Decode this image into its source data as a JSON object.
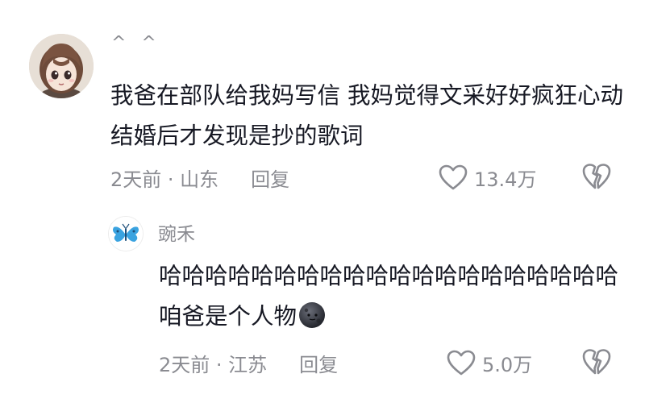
{
  "colors": {
    "text_primary": "#161823",
    "text_secondary": "#8a8b91",
    "background": "#ffffff",
    "icon_stroke": "#8a8b91",
    "butterfly_blue": "#3aa3e0"
  },
  "comment": {
    "avatar_icon": "anime-girl-avatar",
    "username": "^ ^",
    "text": "我爸在部队给我妈写信 我妈觉得文采好好疯狂心动 结婚后才发现是抄的歌词",
    "meta": {
      "time_location": "2天前 · 山东",
      "reply_label": "回复"
    },
    "like_icon": "heart-outline-icon",
    "like_count": "13.4万",
    "dislike_icon": "broken-heart-icon"
  },
  "reply": {
    "avatar_icon": "blue-butterfly-avatar",
    "username": "豌禾",
    "text": "哈哈哈哈哈哈哈哈哈哈哈哈哈哈哈哈哈哈哈哈咱爸是个人物",
    "emoji_icon": "dark-moon-face-emoji",
    "meta": {
      "time_location": "2天前 · 江苏",
      "reply_label": "回复"
    },
    "like_icon": "heart-outline-icon",
    "like_count": "5.0万",
    "dislike_icon": "broken-heart-icon"
  }
}
